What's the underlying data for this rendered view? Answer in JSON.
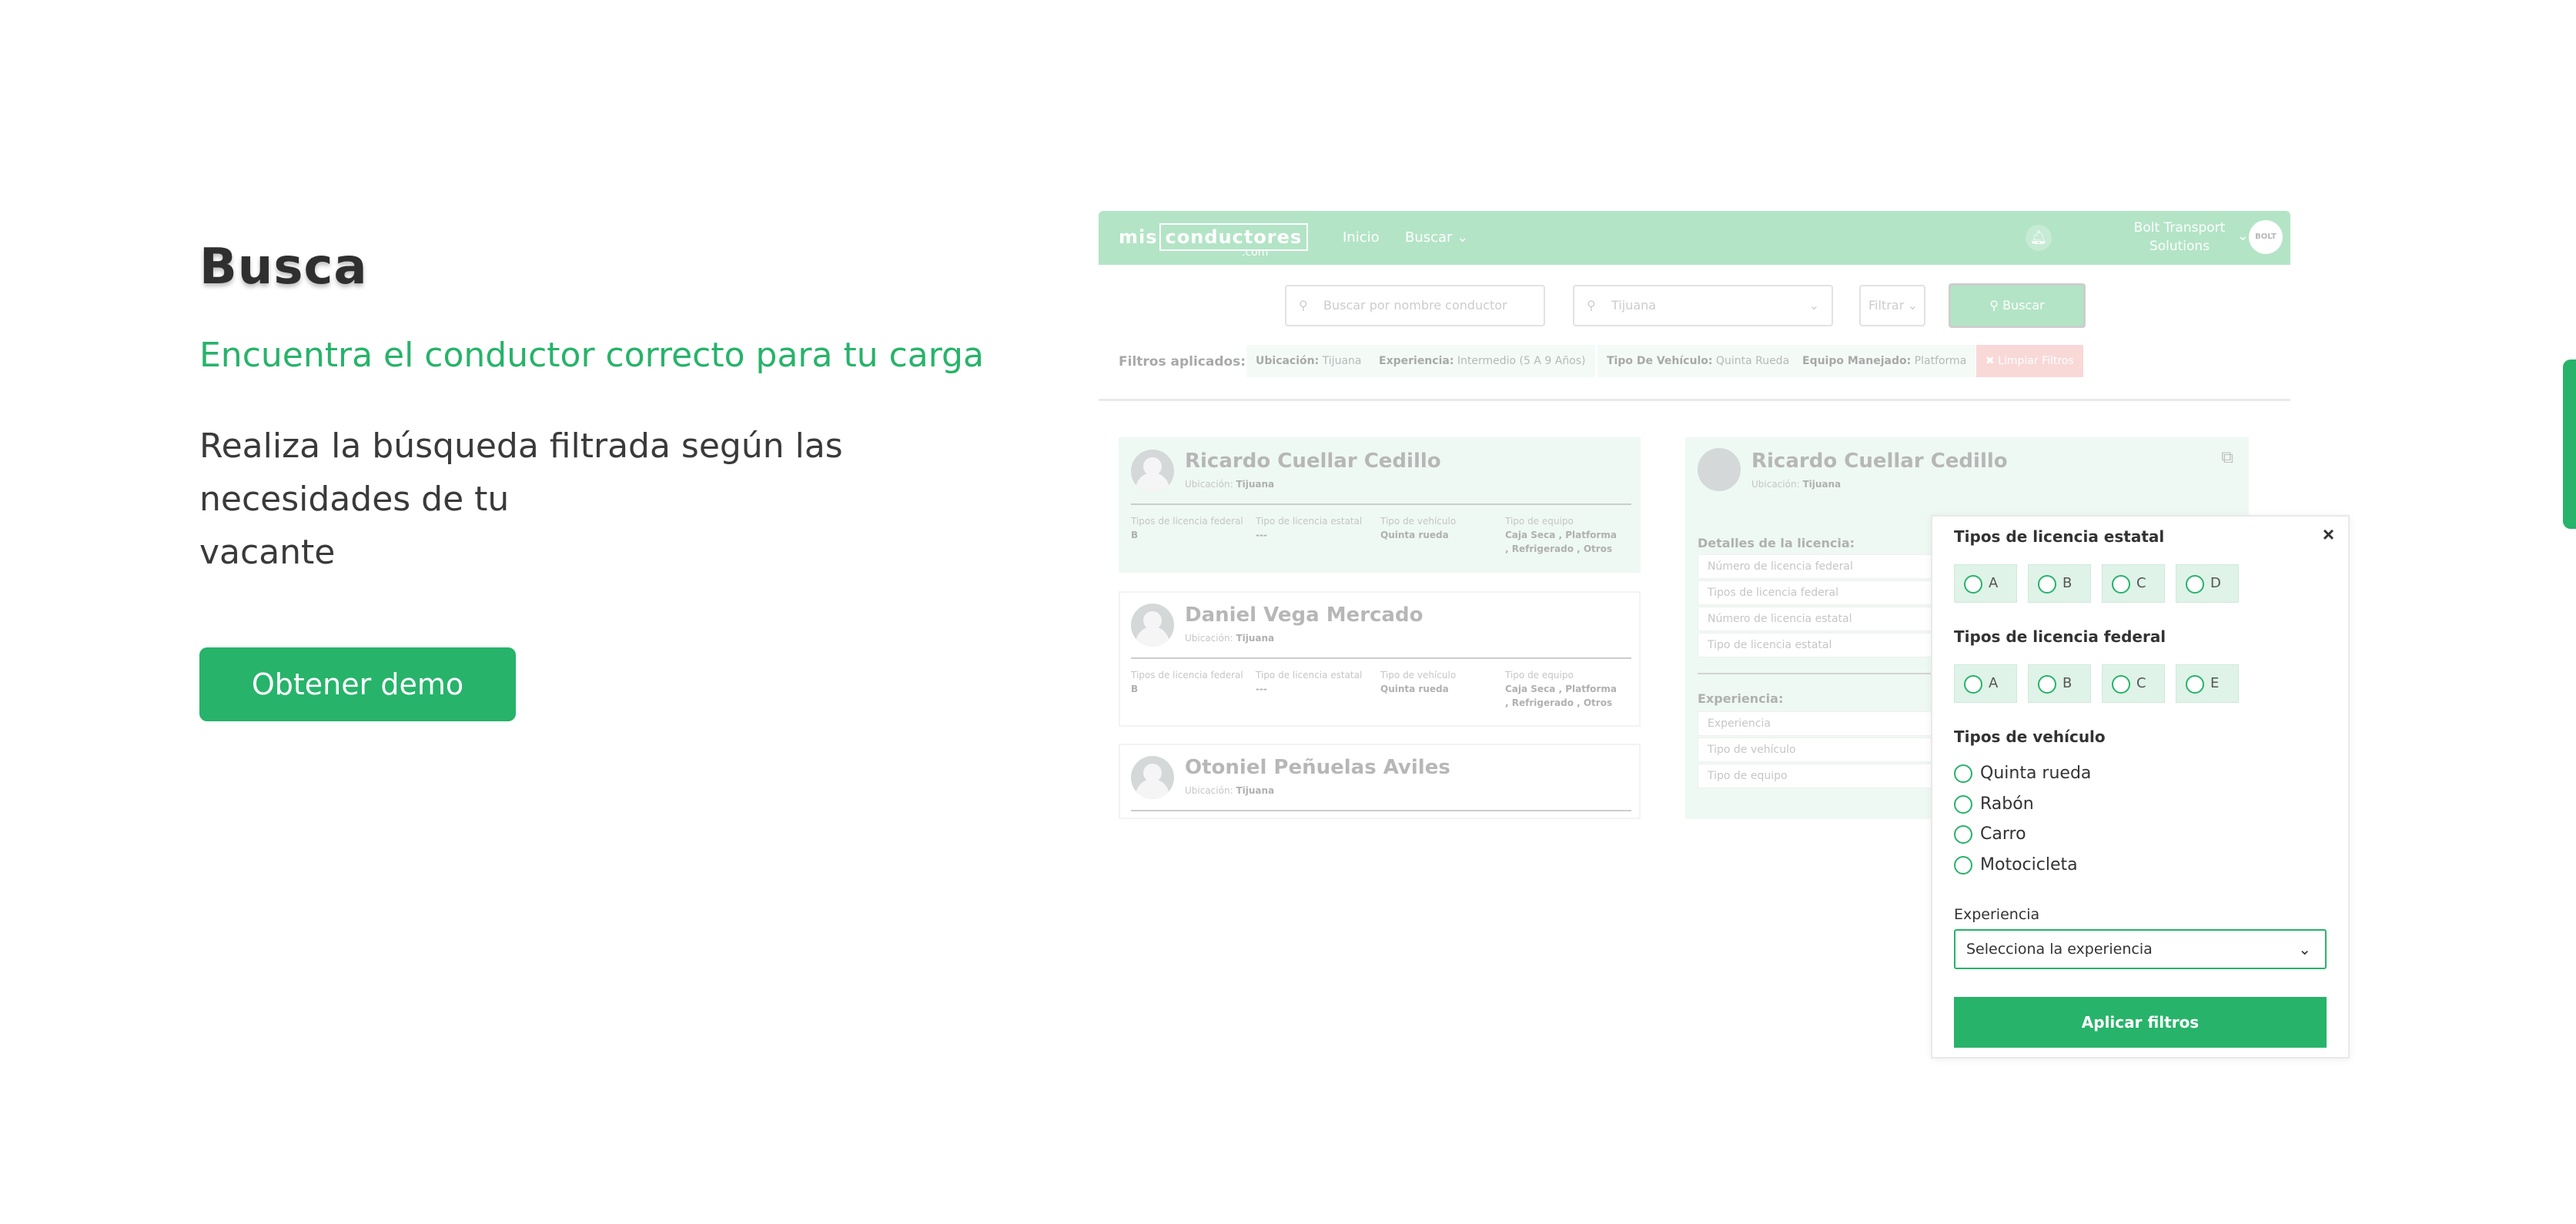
{
  "hero": {
    "title": "Busca",
    "subtitle": "Encuentra el conductor correcto para tu carga",
    "body_lines": [
      "Realiza la búsqueda filtrada según las",
      "necesidades de tu",
      "vacante"
    ],
    "cta_label": "Obtener demo"
  },
  "mockup": {
    "nav": {
      "logo_left": "mis",
      "logo_box": "conductores",
      "logo_suffix": ".com",
      "links": [
        "Inicio",
        "Buscar"
      ],
      "company_line1": "Bolt Transport",
      "company_line2": "Solutions",
      "avatar_text": "BOLT"
    },
    "search": {
      "name_placeholder": "Buscar por nombre conductor",
      "location_value": "Tijuana",
      "filter_label": "Filtrar",
      "button_label": "Buscar"
    },
    "filters": {
      "label": "Filtros aplicados:",
      "chips": [
        {
          "key": "Ubicación:",
          "value": "Tijuana"
        },
        {
          "key": "Experiencia:",
          "value": "Intermedio (5 A 9 Años)"
        },
        {
          "key": "Tipo De Vehículo:",
          "value": "Quinta Rueda"
        },
        {
          "key": "Equipo Manejado:",
          "value": "Platforma"
        }
      ],
      "clear_label": "✖ Limpiar Filtros"
    },
    "cards": [
      {
        "name": "Ricardo Cuellar Cedillo",
        "location_label": "Ubicación:",
        "location": "Tijuana"
      },
      {
        "name": "Daniel Vega Mercado",
        "location_label": "Ubicación:",
        "location": "Tijuana"
      },
      {
        "name": "Otoniel Peñuelas Aviles",
        "location_label": "Ubicación:",
        "location": "Tijuana"
      }
    ],
    "card_columns": {
      "federal_label": "Tipos de licencia federal",
      "federal_value": "B",
      "estatal_label": "Tipo de licencia estatal",
      "estatal_value": "---",
      "vehiculo_label": "Tipo de vehículo",
      "vehiculo_value": "Quinta rueda",
      "equipo_label": "Tipo de equipo",
      "equipo_value": "Caja Seca , Platforma , Refrigerado , Otros"
    },
    "detail": {
      "name": "Ricardo Cuellar Cedillo",
      "location_label": "Ubicación:",
      "location": "Tijuana",
      "license_section": "Detalles de la licencia:",
      "license_fields": [
        "Número de licencia federal",
        "Tipos de licencia federal",
        "Número de licencia estatal",
        "Tipo de licencia estatal"
      ],
      "experience_section": "Experiencia:",
      "experience_fields": [
        "Experiencia",
        "Tipo de vehículo",
        "Tipo de equipo"
      ]
    }
  },
  "popup": {
    "estatal_title": "Tipos de licencia estatal",
    "estatal_options": [
      "A",
      "B",
      "C",
      "D"
    ],
    "federal_title": "Tipos de licencia federal",
    "federal_options": [
      "A",
      "B",
      "C",
      "E"
    ],
    "vehicle_title": "Tipos de vehículo",
    "vehicle_options": [
      "Quinta rueda",
      "Rabón",
      "Carro",
      "Motocicleta"
    ],
    "experience_title": "Experiencia",
    "experience_placeholder": "Selecciona la experiencia",
    "apply_label": "Aplicar filtros",
    "close_symbol": "×"
  },
  "colors": {
    "brand_green": "#27b36a",
    "mock_green": "#4cc07a",
    "light_green": "#d9f1e4",
    "clear_red": "#f2a3a3"
  }
}
